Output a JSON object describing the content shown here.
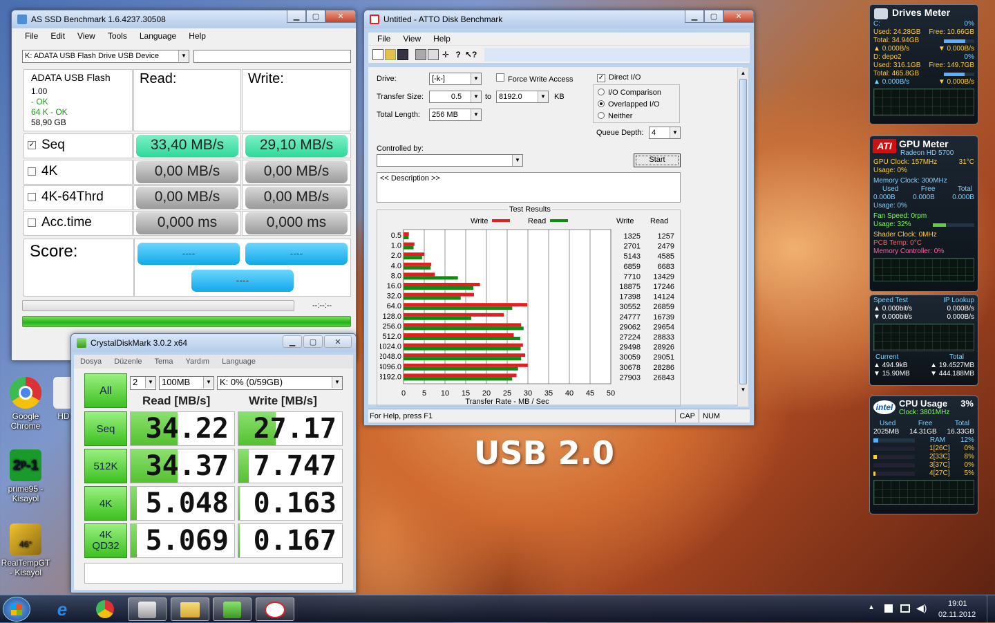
{
  "desktop": {
    "usb_label": "USB 2.0",
    "icons": [
      {
        "label": "Google Chrome"
      },
      {
        "label": "HD"
      },
      {
        "label": "prime95 - Kisayol"
      },
      {
        "label": "RealTempGT - Kisayol"
      }
    ]
  },
  "asssd": {
    "title": "AS SSD Benchmark 1.6.4237.30508",
    "menu": [
      "File",
      "Edit",
      "View",
      "Tools",
      "Language",
      "Help"
    ],
    "drive_select": "K: ADATA USB Flash Drive USB Device",
    "info": {
      "name": "ADATA USB Flash",
      "ver": "1.00",
      "ok1": "- OK",
      "ok2": "64 K - OK",
      "size": "58,90 GB"
    },
    "read_header": "Read:",
    "write_header": "Write:",
    "rows": [
      {
        "label": "Seq",
        "checked": true,
        "read": "33,40 MB/s",
        "write": "29,10 MB/s"
      },
      {
        "label": "4K",
        "checked": false,
        "read": "0,00 MB/s",
        "write": "0,00 MB/s"
      },
      {
        "label": "4K-64Thrd",
        "checked": false,
        "read": "0,00 MB/s",
        "write": "0,00 MB/s"
      },
      {
        "label": "Acc.time",
        "checked": false,
        "read": "0,000 ms",
        "write": "0,000 ms"
      }
    ],
    "score_label": "Score:",
    "score_read": "----",
    "score_write": "----",
    "score_total": "----",
    "time": "--:--:--"
  },
  "cdm": {
    "title": "CrystalDiskMark 3.0.2 x64",
    "menu": [
      "Dosya",
      "Düzenle",
      "Tema",
      "Yardım",
      "Language"
    ],
    "all": "All",
    "count": "2",
    "size": "100MB",
    "drive": "K: 0% (0/59GB)",
    "read_header": "Read [MB/s]",
    "write_header": "Write [MB/s]",
    "rows": [
      {
        "label": "Seq",
        "label2": "",
        "read": "34.22",
        "write": "27.17",
        "read_frac": 0.45,
        "write_frac": 0.36
      },
      {
        "label": "512K",
        "label2": "",
        "read": "34.37",
        "write": "7.747",
        "read_frac": 0.45,
        "write_frac": 0.1
      },
      {
        "label": "4K",
        "label2": "",
        "read": "5.048",
        "write": "0.163",
        "read_frac": 0.06,
        "write_frac": 0.01
      },
      {
        "label": "4K",
        "label2": "QD32",
        "read": "5.069",
        "write": "0.167",
        "read_frac": 0.06,
        "write_frac": 0.01
      }
    ]
  },
  "atto": {
    "title": "Untitled - ATTO Disk Benchmark",
    "menu": [
      "File",
      "View",
      "Help"
    ],
    "drive_label": "Drive:",
    "drive": "[-k-]",
    "force_write": "Force Write Access",
    "direct_io": "Direct I/O",
    "xfer_label": "Transfer Size:",
    "xfer_from": "0.5",
    "xfer_to_label": "to",
    "xfer_to": "8192.0",
    "kb": "KB",
    "length_label": "Total Length:",
    "length": "256 MB",
    "io_comparison": "I/O Comparison",
    "overlapped": "Overlapped I/O",
    "neither": "Neither",
    "queue_label": "Queue Depth:",
    "queue": "4",
    "controlled_label": "Controlled by:",
    "start": "Start",
    "description": "<< Description >>",
    "results_title": "Test Results",
    "legend_write": "Write",
    "legend_read": "Read",
    "col_write": "Write",
    "col_read": "Read",
    "xlabel": "Transfer Rate - MB / Sec",
    "status": "For Help, press F1",
    "cap": "CAP",
    "num": "NUM"
  },
  "chart_data": {
    "type": "bar",
    "orientation": "horizontal",
    "title": "Test Results",
    "xlabel": "Transfer Rate - MB / Sec",
    "xlim": [
      0,
      50
    ],
    "xticks": [
      0,
      5,
      10,
      15,
      20,
      25,
      30,
      35,
      40,
      45,
      50
    ],
    "categories": [
      "0.5",
      "1.0",
      "2.0",
      "4.0",
      "8.0",
      "16.0",
      "32.0",
      "64.0",
      "128.0",
      "256.0",
      "512.0",
      "1024.0",
      "2048.0",
      "4096.0",
      "8192.0"
    ],
    "series": [
      {
        "name": "Write",
        "color": "#e02020",
        "values": [
          1325,
          2701,
          5143,
          6859,
          7710,
          18875,
          17398,
          30552,
          24777,
          29062,
          27224,
          29498,
          30059,
          30678,
          27903
        ]
      },
      {
        "name": "Read",
        "color": "#108a10",
        "values": [
          1257,
          2479,
          4585,
          6683,
          13429,
          17246,
          14124,
          26859,
          16739,
          29654,
          28833,
          28926,
          29051,
          28286,
          26843
        ]
      }
    ]
  },
  "gadgets": {
    "drives": {
      "title": "Drives Meter",
      "c": "C:",
      "c_pct": "0%",
      "c_used": "Used: 24.28GB",
      "c_free": "Free: 10.66GB",
      "c_total": "Total: 34.94GB",
      "c_r": "0.000B/s",
      "c_w": "0.000B/s",
      "d": "D: depo2",
      "d_pct": "0%",
      "d_used": "Used: 316.1GB",
      "d_free": "Free: 149.7GB",
      "d_total": "Total: 465.8GB",
      "d_r": "0.000B/s",
      "d_w": "0.000B/s"
    },
    "gpu": {
      "title": "GPU Meter",
      "model": "Radeon HD 5700",
      "clock": "GPU Clock: 157MHz",
      "temp": "31°C",
      "usage": "Usage: 0%",
      "mem_clock": "Memory Clock: 300MHz",
      "used": "Used",
      "free": "Free",
      "total": "Total",
      "u": "0.000B",
      "f": "0.000B",
      "t": "0.000B",
      "mem_usage": "Usage: 0%",
      "fan": "Fan Speed: 0rpm",
      "fan_usage": "Usage: 32%",
      "shader": "Shader Clock: 0MHz",
      "pcb": "PCB Temp: 0°C",
      "mc": "Memory Controller: 0%"
    },
    "net": {
      "speed": "Speed Test",
      "ip": "IP Lookup",
      "s1": "0.000bit/s",
      "s2": "0.000bit/s",
      "b1": "0.000B/s",
      "b2": "0.000B/s",
      "current": "Current",
      "total": "Total",
      "c1": "494.9kB",
      "c2": "15.90MB",
      "t1": "19.4527MB",
      "t2": "444.188MB"
    },
    "cpu": {
      "title": "CPU Usage",
      "pct": "3%",
      "clock": "Clock: 3801MHz",
      "used": "Used",
      "free": "Free",
      "total": "Total",
      "u": "2025MB",
      "f": "14.31GB",
      "t": "16.33GB",
      "ram": "RAM",
      "ram_pct": "12%",
      "cores": [
        {
          "n": "1[26C]",
          "p": "0%"
        },
        {
          "n": "2[33C]",
          "p": "8%"
        },
        {
          "n": "3[37C]",
          "p": "0%"
        },
        {
          "n": "4[27C]",
          "p": "5%"
        }
      ]
    }
  },
  "taskbar": {
    "time": "19:01",
    "date": "02.11.2012"
  }
}
